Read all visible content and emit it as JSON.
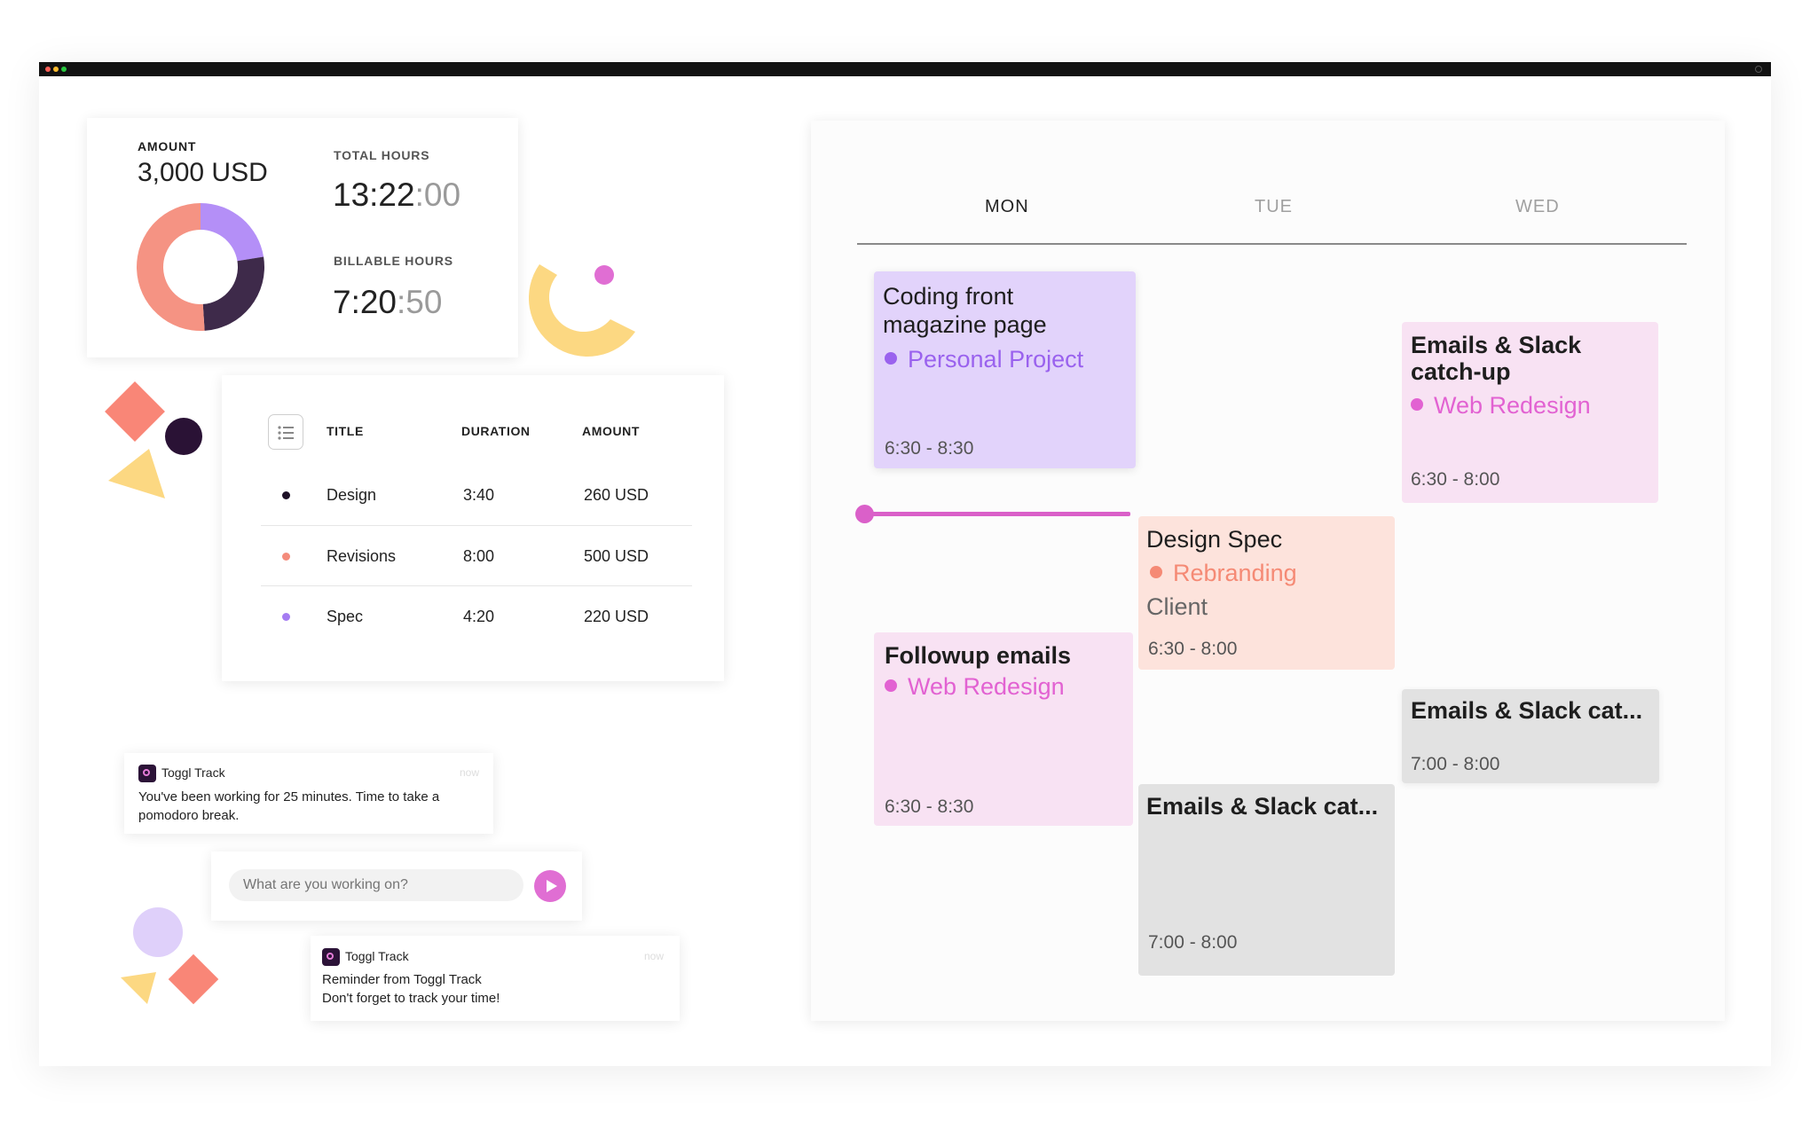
{
  "window": {
    "traffic_lights": [
      "#ff5f57",
      "#febc2e",
      "#28c840"
    ]
  },
  "summary": {
    "amount_label": "AMOUNT",
    "amount_value": "3,000 USD",
    "total_hours_label": "TOTAL HOURS",
    "total_hours_main": "13:22",
    "total_hours_sec": ":00",
    "billable_hours_label": "BILLABLE HOURS",
    "billable_hours_main": "7:20",
    "billable_hours_sec": ":50"
  },
  "chart_data": {
    "type": "pie",
    "slices": [
      {
        "label": "Spec",
        "value": 220,
        "color": "#b48ff7"
      },
      {
        "label": "Design",
        "value": 260,
        "color": "#3e2a4a"
      },
      {
        "label": "Revisions",
        "value": 500,
        "color": "#f59383"
      }
    ]
  },
  "table": {
    "icon": "list-icon",
    "headers": {
      "title": "TITLE",
      "duration": "DURATION",
      "amount": "AMOUNT"
    },
    "rows": [
      {
        "title": "Design",
        "duration": "3:40",
        "amount": "260 USD",
        "color": "#1d1026"
      },
      {
        "title": "Revisions",
        "duration": "8:00",
        "amount": "500 USD",
        "color": "#f48b7b"
      },
      {
        "title": "Spec",
        "duration": "4:20",
        "amount": "220 USD",
        "color": "#a57cf2"
      }
    ]
  },
  "notifications": [
    {
      "app": "Toggl Track",
      "time": "now",
      "line1": "You've been working for 25 minutes. Time to take a",
      "line2": "pomodoro break."
    },
    {
      "app": "Toggl Track",
      "time": "now",
      "line1": "Reminder from Toggl Track",
      "line2": "Don't forget to track your time!"
    }
  ],
  "timer": {
    "placeholder": "What are you working on?",
    "play_icon": "play-icon"
  },
  "calendar": {
    "days": [
      "MON",
      "TUE",
      "WED"
    ],
    "events": [
      {
        "title_lines": [
          "Coding front",
          "magazine page"
        ],
        "project": "Personal Project",
        "time": "6:30 - 8:30",
        "bg": "#e2d3fb",
        "accent": "#9a62ee"
      },
      {
        "title_lines": [
          "Followup emails"
        ],
        "project": "Web Redesign",
        "time": "6:30 - 8:30",
        "bg": "#f8e2f3",
        "accent": "#e262d2"
      },
      {
        "title_lines": [
          "Design Spec"
        ],
        "project": "Rebranding",
        "client": "Client",
        "time": "6:30 - 8:00",
        "bg": "#fde3dc",
        "accent": "#f58a75"
      },
      {
        "title_lines": [
          "Emails & Slack cat..."
        ],
        "time": "7:00 - 8:00",
        "bg": "#e2e2e2"
      },
      {
        "title_lines": [
          "Emails & Slack",
          "catch-up"
        ],
        "project": "Web Redesign",
        "time": "6:30 - 8:00",
        "bg": "#f8e2f3",
        "accent": "#e262d2"
      },
      {
        "title_lines": [
          "Emails & Slack cat..."
        ],
        "time": "7:00 - 8:00",
        "bg": "#e2e2e2"
      }
    ],
    "now_line_color": "#da60c9"
  },
  "decor_colors": {
    "coral": "#f98677",
    "dark": "#2a1235",
    "yellow": "#fcd882",
    "pink": "#e06ed3",
    "lavender": "#dfd0fa"
  }
}
